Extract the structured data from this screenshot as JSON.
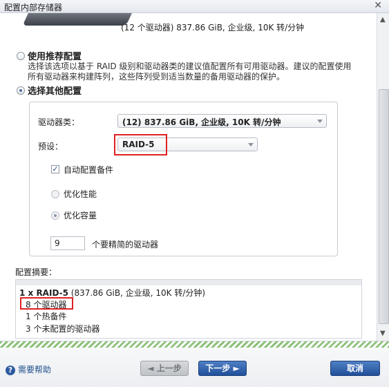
{
  "window": {
    "title": "配置内部存储器",
    "close_glyph": "✕"
  },
  "top": {
    "drive_summary": "(12 个驱动器) 837.86 GiB, 企业级, 10K 转/分钟"
  },
  "options": {
    "recommended": {
      "label": "使用推荐配置",
      "description": "选择该选项以基于 RAID 级别和驱动器类的建议值配置所有可用驱动器。建议的配置使用所有驱动器来构建阵列，这些阵列受到适当数量的备用驱动器的保护。",
      "selected": false
    },
    "other": {
      "label": "选择其他配置",
      "selected": true
    }
  },
  "panel": {
    "drive_class_label": "驱动器类：",
    "drive_class_value": "(12) 837.86 GiB, 企业级, 10K 转/分钟",
    "preset_label": "预设：",
    "preset_value": "RAID-5",
    "auto_spare_label": "自动配置备件",
    "auto_spare_checked": true,
    "optimize_performance_label": "优化性能",
    "optimize_capacity_label": "优化容量",
    "selected_optimization": "优化容量",
    "drive_count_value": "9",
    "drive_count_label": "个要精简的驱动器"
  },
  "summary": {
    "heading": "配置摘要：",
    "line1_bold": "1 x RAID-5",
    "line1_rest": " (837.86 GiB, 企业级, 10K 转/分钟)",
    "line2": "8 个驱动器",
    "line3": "1 个热备件",
    "line4": "3 个未配置的驱动器"
  },
  "footer": {
    "help_label": "需要帮助",
    "back_label": "◄ 上一步",
    "next_label": "下一步 ►",
    "cancel_label": "取消"
  },
  "highlight_color": "#e02020"
}
